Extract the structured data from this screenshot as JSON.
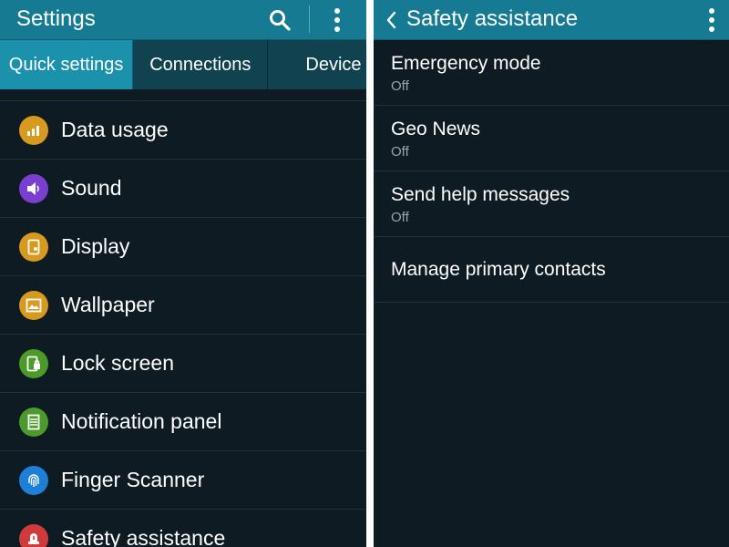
{
  "colors": {
    "appbar": "#167a92",
    "tab_active": "#1b91ac",
    "tab_inactive": "#10424f",
    "background": "#0f1b22",
    "separator": "#23323a",
    "secondary_text": "#9aa4aa"
  },
  "settings": {
    "title": "Settings",
    "actions": [
      "search-icon",
      "more-vert-icon"
    ],
    "tabs": [
      {
        "label": "Quick settings",
        "active": true
      },
      {
        "label": "Connections",
        "active": false
      },
      {
        "label": "Device",
        "active": false
      }
    ],
    "items": [
      {
        "label": "Data usage",
        "icon": "bar-chart-icon",
        "icon_color": "#d79a1e"
      },
      {
        "label": "Sound",
        "icon": "speaker-icon",
        "icon_color": "#7a3fd0"
      },
      {
        "label": "Display",
        "icon": "display-icon",
        "icon_color": "#d79a1e"
      },
      {
        "label": "Wallpaper",
        "icon": "image-icon",
        "icon_color": "#d79a1e"
      },
      {
        "label": "Lock screen",
        "icon": "lock-screen-icon",
        "icon_color": "#4c9a2a"
      },
      {
        "label": "Notification panel",
        "icon": "notification-panel-icon",
        "icon_color": "#4c9a2a"
      },
      {
        "label": "Finger Scanner",
        "icon": "fingerprint-icon",
        "icon_color": "#1e7fd6"
      },
      {
        "label": "Safety assistance",
        "icon": "safety-icon",
        "icon_color": "#d13a3a"
      }
    ]
  },
  "safety": {
    "title": "Safety assistance",
    "items": [
      {
        "label": "Emergency mode",
        "status": "Off"
      },
      {
        "label": "Geo News",
        "status": "Off"
      },
      {
        "label": "Send help messages",
        "status": "Off"
      },
      {
        "label": "Manage primary contacts",
        "status": ""
      }
    ]
  }
}
